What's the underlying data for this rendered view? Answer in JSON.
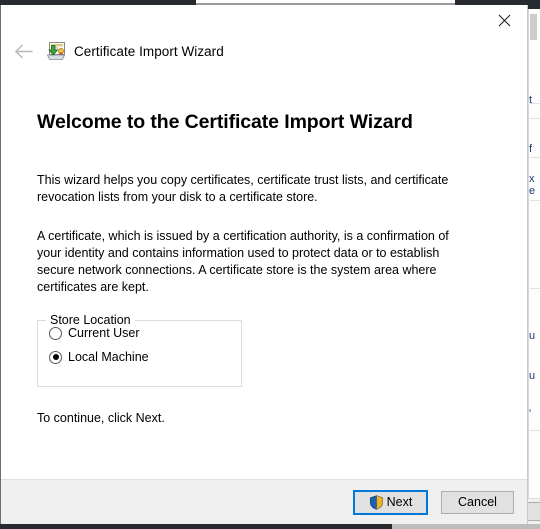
{
  "window": {
    "title": "Certificate Import Wizard",
    "icon": "certificate-import-icon",
    "back_label": "Back",
    "close_label": "Close"
  },
  "content": {
    "heading": "Welcome to the Certificate Import Wizard",
    "paragraph1": "This wizard helps you copy certificates, certificate trust lists, and certificate revocation lists from your disk to a certificate store.",
    "paragraph2": "A certificate, which is issued by a certification authority, is a confirmation of your identity and contains information used to protect data or to establish secure network connections. A certificate store is the system area where certificates are kept.",
    "footnote": "To continue, click Next."
  },
  "store_location": {
    "legend": "Store Location",
    "options": [
      {
        "label": "Current User",
        "selected": false
      },
      {
        "label": "Local Machine",
        "selected": true
      }
    ]
  },
  "footer": {
    "next_label": "Next",
    "cancel_label": "Cancel",
    "next_has_shield": true
  },
  "background": {
    "button_label": "el",
    "fragments": [
      "t",
      "f",
      "x",
      "e",
      "u",
      "u",
      "'"
    ]
  },
  "colors": {
    "accent": "#0078d7",
    "window_bg": "#ffffff",
    "footer_bg": "#f0f0f0",
    "button_bg": "#e1e1e1",
    "button_border": "#adadad",
    "text": "#000000",
    "groupbox_border": "#dcdcdc",
    "desktop_dark": "#272b30"
  }
}
